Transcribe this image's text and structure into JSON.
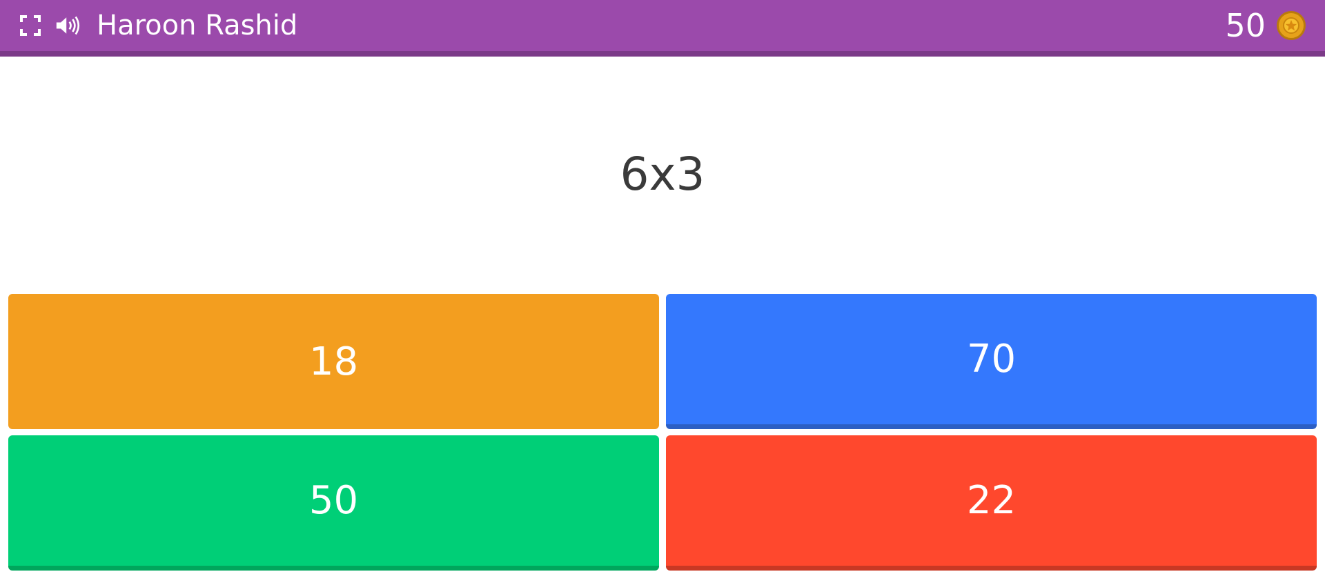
{
  "header": {
    "player_name": "Haroon Rashid",
    "coins": "50",
    "fullscreen_icon": "fullscreen-icon",
    "sound_icon": "speaker-icon",
    "coin_icon": "coin-icon"
  },
  "question": {
    "text": "6x3"
  },
  "answers": [
    {
      "label": "18",
      "color": "#f39e1f"
    },
    {
      "label": "70",
      "color": "#3478fd"
    },
    {
      "label": "50",
      "color": "#00cf77"
    },
    {
      "label": "22",
      "color": "#ff482d"
    }
  ],
  "colors": {
    "header_bg": "#9b4aab",
    "header_border": "#7b3a88"
  }
}
